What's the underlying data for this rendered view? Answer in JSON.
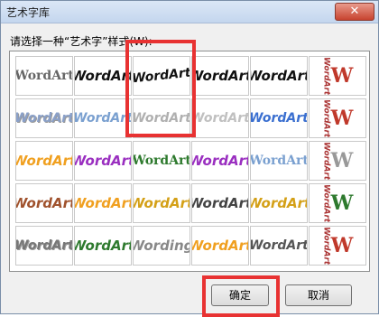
{
  "window": {
    "title": "艺术字库",
    "close_icon": "close-icon"
  },
  "prompt": "请选择一种“艺术字”样式(W):",
  "gallery": {
    "rows": [
      [
        "WordArt",
        "WordArt",
        "WordArt",
        "WordArt",
        "WordArt",
        "W"
      ],
      [
        "WordArt",
        "WordArt",
        "WordArt",
        "WordArt",
        "WordArt",
        "W"
      ],
      [
        "WordArt",
        "WordArt",
        "WordArt",
        "WordArt",
        "WordArt",
        "W"
      ],
      [
        "WordArt",
        "WordArt",
        "WordArt",
        "WordArt",
        "WordArt",
        "W"
      ],
      [
        "WordArt",
        "WordArt",
        "Wording",
        "WordArt",
        "WordArt",
        "W"
      ]
    ],
    "vertical_text": "WordArt",
    "selected": "row 1, column 3",
    "colors": {
      "highlight": "#e83232",
      "orange": "#f0a020",
      "blue": "#3a6fd0",
      "purple": "#9a2fc0",
      "green": "#2e7a2e",
      "gold": "#d4a017",
      "red": "#c0392b"
    }
  },
  "buttons": {
    "ok": "确定",
    "cancel": "取消"
  }
}
